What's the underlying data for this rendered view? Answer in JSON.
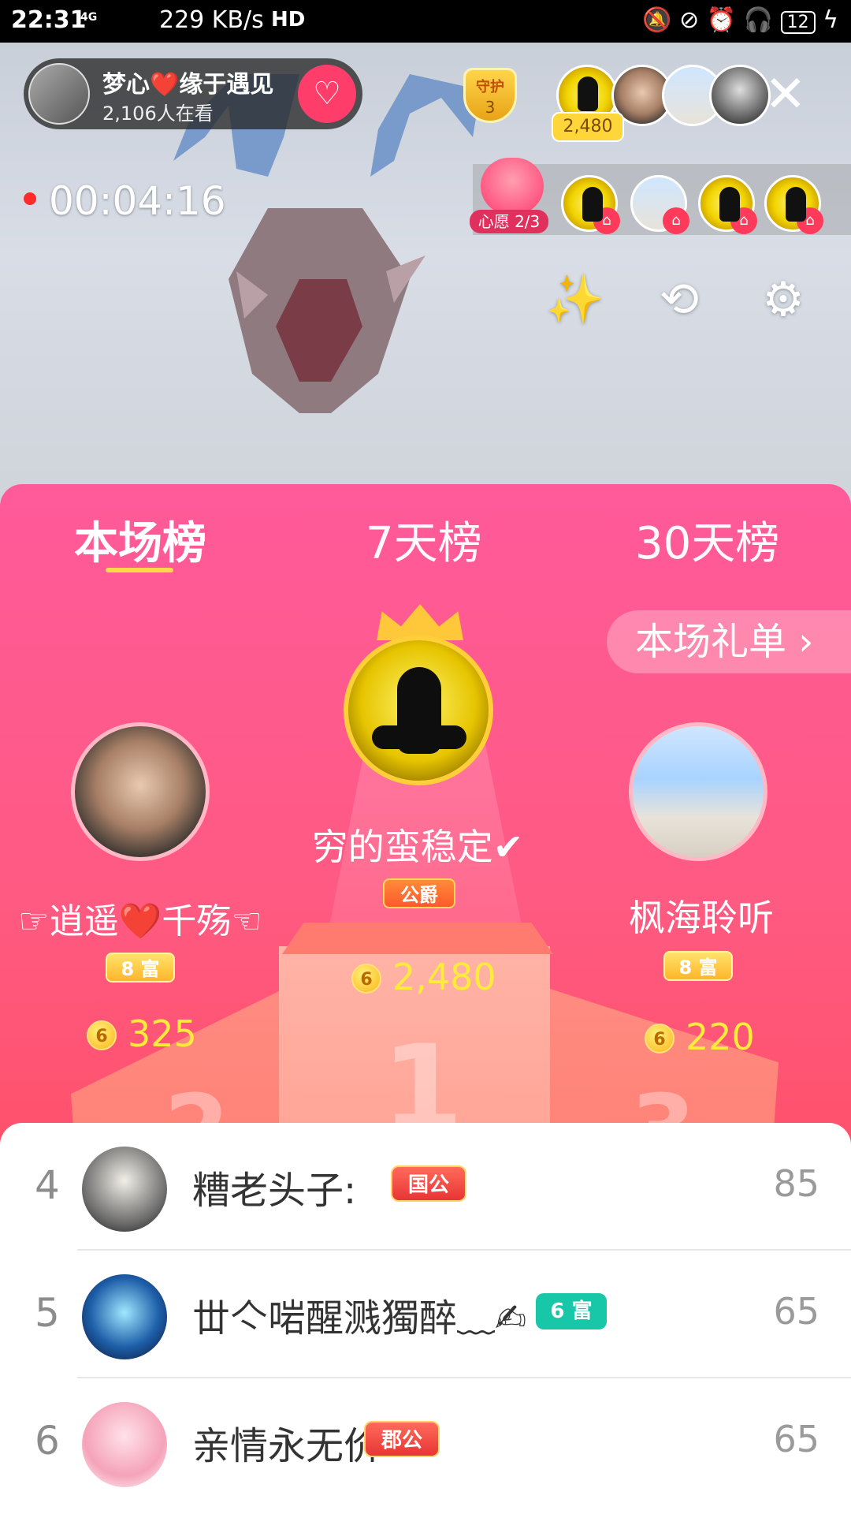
{
  "status_bar": {
    "time": "22:31",
    "network": "4G",
    "speed": "229 KB/s",
    "hd": "HD",
    "battery": "12"
  },
  "host": {
    "name": "梦心❤️缘于遇见",
    "viewers": "2,106人在看",
    "follow_icon": "heart-plus-icon"
  },
  "guard": {
    "label": "守护",
    "count": "3"
  },
  "top_viewers": {
    "coins": "2,480"
  },
  "recording": {
    "time": "00:04:16"
  },
  "wish": {
    "label": "心愿 2/3"
  },
  "tabs": [
    {
      "label": "本场榜",
      "active": true
    },
    {
      "label": "7天榜",
      "active": false
    },
    {
      "label": "30天榜",
      "active": false
    }
  ],
  "gift_list_button": "本场礼单 ›",
  "podium": {
    "first": {
      "name": "穷的蛮稳定✔",
      "badge": "公爵",
      "score": "2,480"
    },
    "second": {
      "name": "☞逍遥❤️千殇☜",
      "badge": "8 富",
      "score": "325"
    },
    "third": {
      "name": "枫海聆听",
      "badge": "8 富",
      "score": "220"
    },
    "numbers": [
      "1",
      "2",
      "3"
    ]
  },
  "coin_glyph": "6",
  "list": [
    {
      "rank": "4",
      "name": "糟老头子:",
      "badge": "国公",
      "score": "85"
    },
    {
      "rank": "5",
      "name": "丗亽啱醒溅獨醉﹏✍",
      "badge": "6 富",
      "score": "65"
    },
    {
      "rank": "6",
      "name": "亲情永无价",
      "badge": "郡公",
      "score": "65"
    }
  ],
  "colors": {
    "panel_pink": "#ff5a9a",
    "panel_red": "#ff4d58",
    "gold": "#ffeb3b",
    "accent_underline": "#ffd94a"
  }
}
